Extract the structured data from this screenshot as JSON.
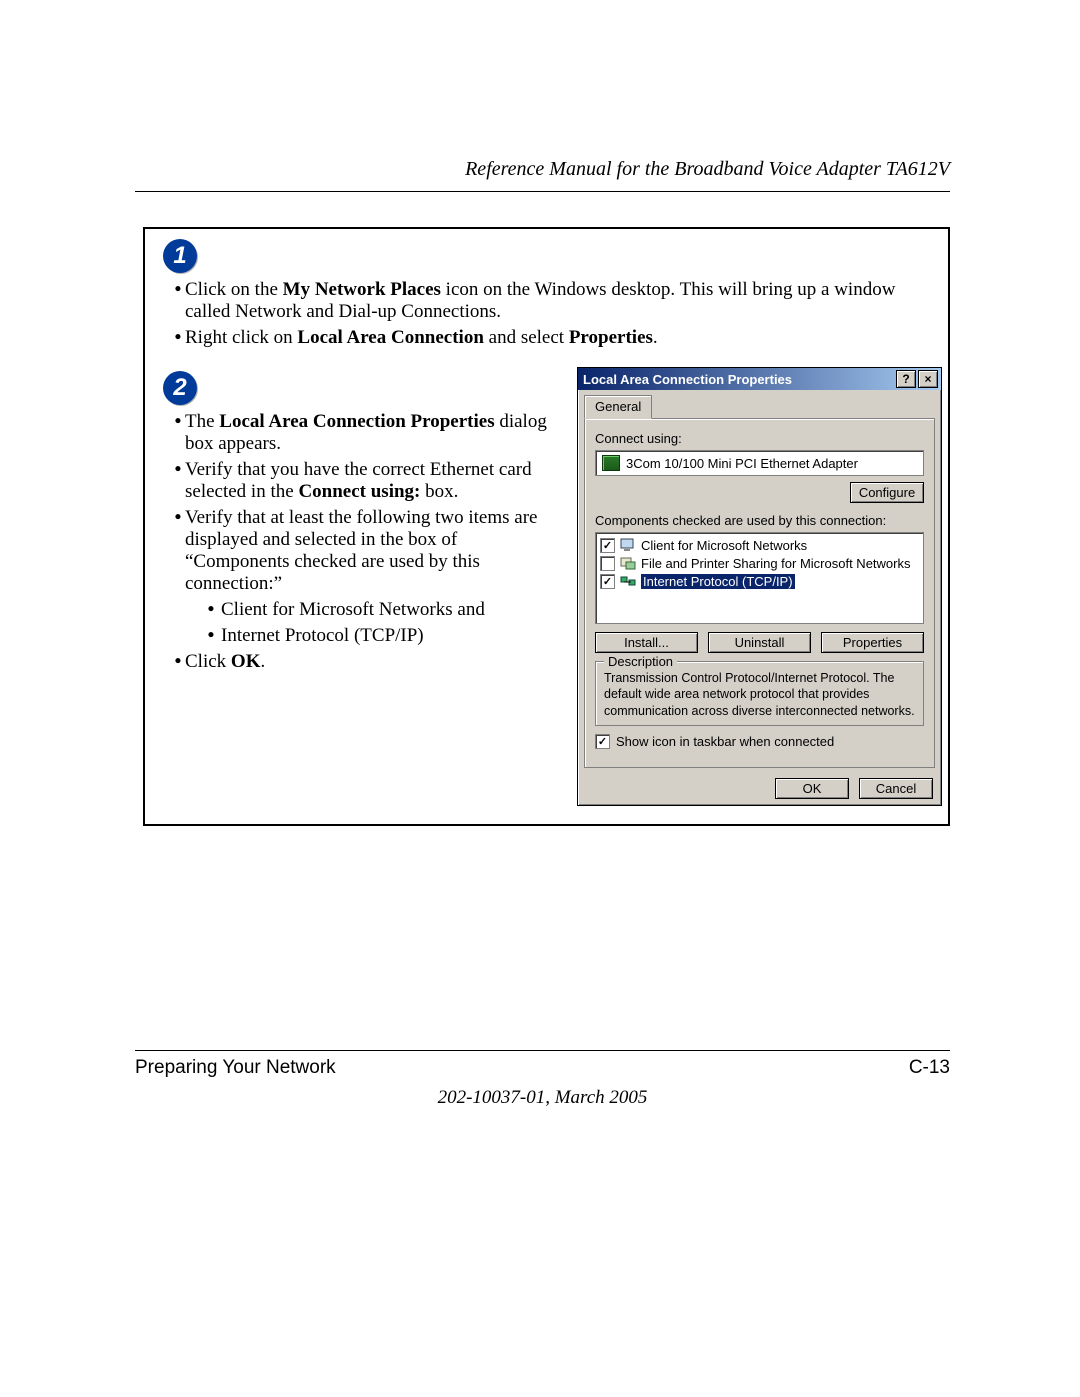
{
  "header": {
    "title": "Reference Manual for the Broadband Voice Adapter TA612V"
  },
  "step1": {
    "badge": "1",
    "bullet1": {
      "pre": "Click on the ",
      "bold": "My Network Places",
      "post": " icon on the Windows desktop.  This will bring up a window called Network and Dial-up Connections."
    },
    "bullet2": {
      "pre": "Right click on ",
      "bold1": "Local Area Connection",
      "mid": " and select ",
      "bold2": "Properties",
      "post": "."
    }
  },
  "step2": {
    "badge": "2",
    "left": {
      "b1": {
        "pre": "The ",
        "bold": "Local Area Connection Properties",
        "post": " dialog box appears."
      },
      "b2": {
        "pre": "Verify that you have the correct Ethernet card selected in the ",
        "bold": "Connect using:",
        "post": " box."
      },
      "b3": "Verify that at least the following two items are displayed and selected in the box of “Components checked are used by this connection:”",
      "sub1": "Client for Microsoft Networks and",
      "sub2": "Internet Protocol (TCP/IP)",
      "b4": {
        "pre": "Click ",
        "bold": "OK",
        "post": "."
      }
    }
  },
  "dialog": {
    "title": "Local Area Connection Properties",
    "help_btn": "?",
    "close_btn": "×",
    "tab_general": "General",
    "connect_using_label": "Connect using:",
    "adapter": "3Com 10/100 Mini PCI Ethernet Adapter",
    "configure_btn": "Configure",
    "components_label": "Components checked are used by this connection:",
    "items": [
      {
        "checked": true,
        "label": "Client for Microsoft Networks",
        "selected": false,
        "icon": "monitor"
      },
      {
        "checked": false,
        "label": "File and Printer Sharing for Microsoft Networks",
        "selected": false,
        "icon": "share"
      },
      {
        "checked": true,
        "label": "Internet Protocol (TCP/IP)",
        "selected": true,
        "icon": "net"
      }
    ],
    "install_btn": "Install...",
    "uninstall_btn": "Uninstall",
    "properties_btn": "Properties",
    "desc_legend": "Description",
    "desc_text": "Transmission Control Protocol/Internet Protocol. The default wide area network protocol that provides communication across diverse interconnected networks.",
    "show_icon_label": "Show icon in taskbar when connected",
    "show_icon_checked": true,
    "ok_btn": "OK",
    "cancel_btn": "Cancel"
  },
  "footer": {
    "section": "Preparing Your Network",
    "page": "C-13",
    "docid": "202-10037-01, March 2005"
  }
}
